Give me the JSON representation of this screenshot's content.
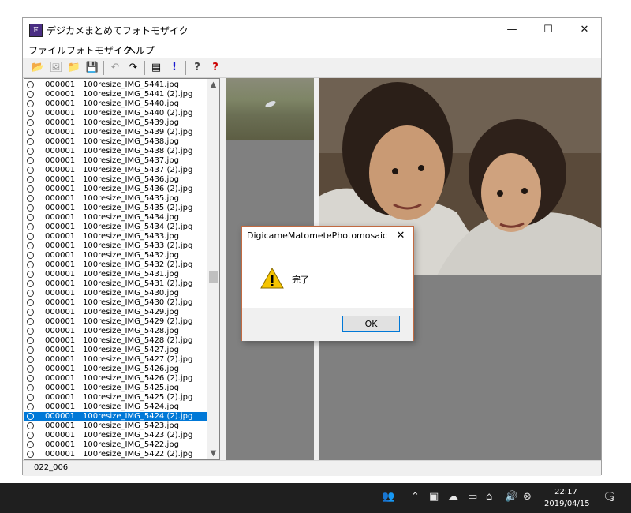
{
  "window": {
    "title": "デジカメまとめてフォトモザイク",
    "controls": {
      "minimize": "—",
      "maximize": "☐",
      "close": "✕"
    }
  },
  "menu": [
    "ファイル",
    "フォトモザイク",
    "ヘルプ"
  ],
  "toolbar": {
    "icons": [
      "open-folder-icon",
      "gallery-icon",
      "folder-icon",
      "save-icon",
      "undo-icon",
      "redo-icon",
      "list-icon",
      "exclamation-icon",
      "help-icon",
      "context-help-icon"
    ],
    "glyphs": [
      "📂",
      "🖼",
      "📁",
      "💾",
      "↶",
      "↷",
      "▤",
      "!",
      "?",
      "?"
    ]
  },
  "file_list": {
    "selected_index": 35,
    "rows": [
      {
        "num": "000001",
        "name": "100resize_IMG_5441.jpg"
      },
      {
        "num": "000001",
        "name": "100resize_IMG_5441 (2).jpg"
      },
      {
        "num": "000001",
        "name": "100resize_IMG_5440.jpg"
      },
      {
        "num": "000001",
        "name": "100resize_IMG_5440 (2).jpg"
      },
      {
        "num": "000001",
        "name": "100resize_IMG_5439.jpg"
      },
      {
        "num": "000001",
        "name": "100resize_IMG_5439 (2).jpg"
      },
      {
        "num": "000001",
        "name": "100resize_IMG_5438.jpg"
      },
      {
        "num": "000001",
        "name": "100resize_IMG_5438 (2).jpg"
      },
      {
        "num": "000001",
        "name": "100resize_IMG_5437.jpg"
      },
      {
        "num": "000001",
        "name": "100resize_IMG_5437 (2).jpg"
      },
      {
        "num": "000001",
        "name": "100resize_IMG_5436.jpg"
      },
      {
        "num": "000001",
        "name": "100resize_IMG_5436 (2).jpg"
      },
      {
        "num": "000001",
        "name": "100resize_IMG_5435.jpg"
      },
      {
        "num": "000001",
        "name": "100resize_IMG_5435 (2).jpg"
      },
      {
        "num": "000001",
        "name": "100resize_IMG_5434.jpg"
      },
      {
        "num": "000001",
        "name": "100resize_IMG_5434 (2).jpg"
      },
      {
        "num": "000001",
        "name": "100resize_IMG_5433.jpg"
      },
      {
        "num": "000001",
        "name": "100resize_IMG_5433 (2).jpg"
      },
      {
        "num": "000001",
        "name": "100resize_IMG_5432.jpg"
      },
      {
        "num": "000001",
        "name": "100resize_IMG_5432 (2).jpg"
      },
      {
        "num": "000001",
        "name": "100resize_IMG_5431.jpg"
      },
      {
        "num": "000001",
        "name": "100resize_IMG_5431 (2).jpg"
      },
      {
        "num": "000001",
        "name": "100resize_IMG_5430.jpg"
      },
      {
        "num": "000001",
        "name": "100resize_IMG_5430 (2).jpg"
      },
      {
        "num": "000001",
        "name": "100resize_IMG_5429.jpg"
      },
      {
        "num": "000001",
        "name": "100resize_IMG_5429 (2).jpg"
      },
      {
        "num": "000001",
        "name": "100resize_IMG_5428.jpg"
      },
      {
        "num": "000001",
        "name": "100resize_IMG_5428 (2).jpg"
      },
      {
        "num": "000001",
        "name": "100resize_IMG_5427.jpg"
      },
      {
        "num": "000001",
        "name": "100resize_IMG_5427 (2).jpg"
      },
      {
        "num": "000001",
        "name": "100resize_IMG_5426.jpg"
      },
      {
        "num": "000001",
        "name": "100resize_IMG_5426 (2).jpg"
      },
      {
        "num": "000001",
        "name": "100resize_IMG_5425.jpg"
      },
      {
        "num": "000001",
        "name": "100resize_IMG_5425 (2).jpg"
      },
      {
        "num": "000001",
        "name": "100resize_IMG_5424.jpg"
      },
      {
        "num": "000001",
        "name": "100resize_IMG_5424 (2).jpg"
      },
      {
        "num": "000001",
        "name": "100resize_IMG_5423.jpg"
      },
      {
        "num": "000001",
        "name": "100resize_IMG_5423 (2).jpg"
      },
      {
        "num": "000001",
        "name": "100resize_IMG_5422.jpg"
      },
      {
        "num": "000001",
        "name": "100resize_IMG_5422 (2).jpg"
      }
    ]
  },
  "status": {
    "text": "022_006"
  },
  "dialog": {
    "title": "DigicameMatometePhotomosaic",
    "close": "✕",
    "message": "完了",
    "ok": "OK"
  },
  "taskbar": {
    "time": "22:17",
    "date": "2019/04/15",
    "notification_count": "3"
  }
}
